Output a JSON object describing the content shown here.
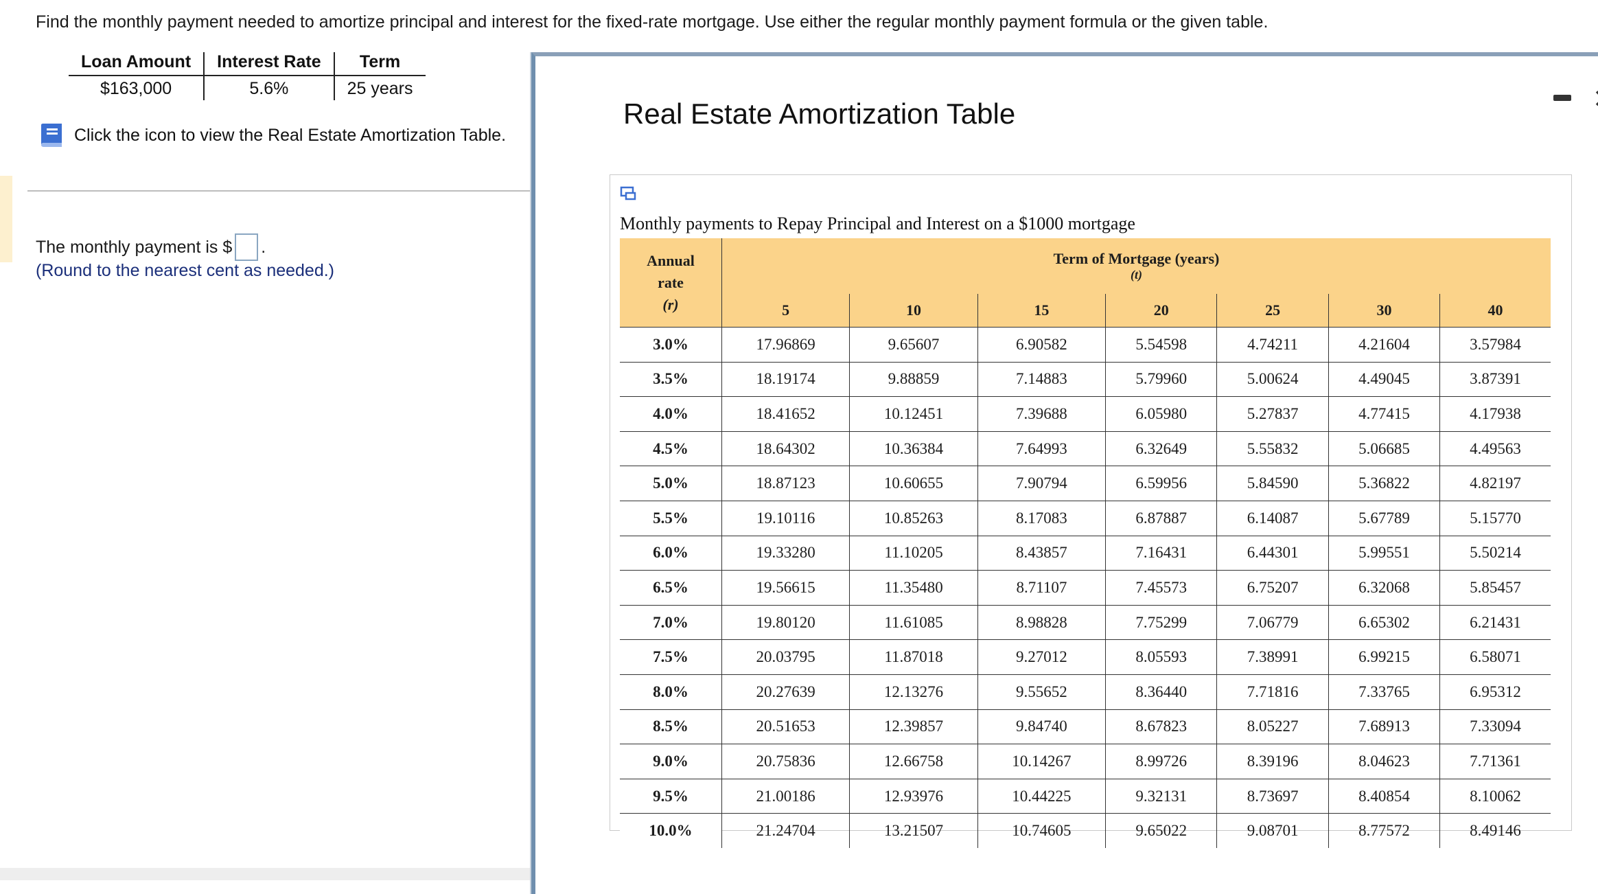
{
  "question": "Find the monthly payment needed to amortize principal and interest for the fixed-rate mortgage. Use either the regular monthly payment formula or the given table.",
  "given": {
    "headers": [
      "Loan Amount",
      "Interest Rate",
      "Term"
    ],
    "values": [
      "$163,000",
      "5.6%",
      "25 years"
    ]
  },
  "icon_link": "Click the icon to view the Real Estate Amortization Table.",
  "answer": {
    "prefix": "The monthly payment is $",
    "value": "",
    "suffix": ".",
    "note": "(Round to the nearest cent as needed.)"
  },
  "popup": {
    "title": "Real Estate Amortization Table",
    "caption": "Monthly payments to Repay Principal and Interest on a $1000 mortgage",
    "rate_header": [
      "Annual",
      "rate",
      "(r)"
    ],
    "term_header": "Term of Mortgage (years)",
    "term_sub": "(t)",
    "terms": [
      "5",
      "10",
      "15",
      "20",
      "25",
      "30",
      "40"
    ],
    "rows": [
      {
        "rate": "3.0%",
        "values": [
          "17.96869",
          "9.65607",
          "6.90582",
          "5.54598",
          "4.74211",
          "4.21604",
          "3.57984"
        ]
      },
      {
        "rate": "3.5%",
        "values": [
          "18.19174",
          "9.88859",
          "7.14883",
          "5.79960",
          "5.00624",
          "4.49045",
          "3.87391"
        ]
      },
      {
        "rate": "4.0%",
        "values": [
          "18.41652",
          "10.12451",
          "7.39688",
          "6.05980",
          "5.27837",
          "4.77415",
          "4.17938"
        ]
      },
      {
        "rate": "4.5%",
        "values": [
          "18.64302",
          "10.36384",
          "7.64993",
          "6.32649",
          "5.55832",
          "5.06685",
          "4.49563"
        ]
      },
      {
        "rate": "5.0%",
        "values": [
          "18.87123",
          "10.60655",
          "7.90794",
          "6.59956",
          "5.84590",
          "5.36822",
          "4.82197"
        ]
      },
      {
        "rate": "5.5%",
        "values": [
          "19.10116",
          "10.85263",
          "8.17083",
          "6.87887",
          "6.14087",
          "5.67789",
          "5.15770"
        ]
      },
      {
        "rate": "6.0%",
        "values": [
          "19.33280",
          "11.10205",
          "8.43857",
          "7.16431",
          "6.44301",
          "5.99551",
          "5.50214"
        ]
      },
      {
        "rate": "6.5%",
        "values": [
          "19.56615",
          "11.35480",
          "8.71107",
          "7.45573",
          "6.75207",
          "6.32068",
          "5.85457"
        ]
      },
      {
        "rate": "7.0%",
        "values": [
          "19.80120",
          "11.61085",
          "8.98828",
          "7.75299",
          "7.06779",
          "6.65302",
          "6.21431"
        ]
      },
      {
        "rate": "7.5%",
        "values": [
          "20.03795",
          "11.87018",
          "9.27012",
          "8.05593",
          "7.38991",
          "6.99215",
          "6.58071"
        ]
      },
      {
        "rate": "8.0%",
        "values": [
          "20.27639",
          "12.13276",
          "9.55652",
          "8.36440",
          "7.71816",
          "7.33765",
          "6.95312"
        ]
      },
      {
        "rate": "8.5%",
        "values": [
          "20.51653",
          "12.39857",
          "9.84740",
          "8.67823",
          "8.05227",
          "7.68913",
          "7.33094"
        ]
      },
      {
        "rate": "9.0%",
        "values": [
          "20.75836",
          "12.66758",
          "10.14267",
          "8.99726",
          "8.39196",
          "8.04623",
          "7.71361"
        ]
      },
      {
        "rate": "9.5%",
        "values": [
          "21.00186",
          "12.93976",
          "10.44225",
          "9.32131",
          "8.73697",
          "8.40854",
          "8.10062"
        ]
      },
      {
        "rate": "10.0%",
        "values": [
          "21.24704",
          "13.21507",
          "10.74605",
          "9.65022",
          "9.08701",
          "8.77572",
          "8.49146"
        ]
      }
    ]
  },
  "colors": {
    "header_fill": "#fbd38a",
    "note_text": "#1b2f7a",
    "book_icon": "#3b6fd1"
  }
}
